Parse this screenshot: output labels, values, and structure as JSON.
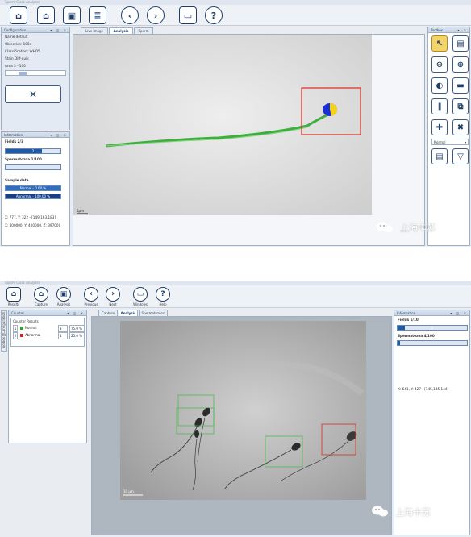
{
  "top": {
    "title": "Sperm Class Analyzer",
    "toolbar_icons": [
      "home-icon",
      "document-home-icon",
      "image-icon",
      "report-icon",
      "previous-icon",
      "next-icon",
      "window-icon",
      "help-icon"
    ],
    "configuration": {
      "header": "Configuration",
      "name": "Name default",
      "objective": "Objective: 100x",
      "classification": "Classification: WHO5",
      "stain": "Stain Diff-quik",
      "area": "Area 5 - 100"
    },
    "information": {
      "header": "Information",
      "fields": "Fields 2/3",
      "fields_bar_value": "2",
      "fields_progress": 0.66,
      "spermatozoa": "Spermatozoa 1/100",
      "spermatozoa_progress": 0.01,
      "sample_data": "Sample data",
      "normal": "Normal - 0.00 %",
      "abnormal": "Abnormal - 100.00 %",
      "coords1": "X: 777, Y: 322 - [149,163,183]",
      "coords2": "X: 400000, Y: 400000, Z: 397000"
    },
    "tabs": [
      "Live image",
      "Analysis",
      "Sperm"
    ],
    "active_tab": "Analysis",
    "scale_label": "5µm",
    "toolbox": {
      "header": "Toolbox",
      "icons": [
        "select-arrow-icon",
        "report-icon",
        "zoom-out-icon",
        "zoom-in-icon",
        "stain-icon",
        "measure-icon",
        "pause-icon",
        "copy-icon",
        "add-icon",
        "delete-icon",
        "save-icon",
        "filter-icon"
      ],
      "dropdown": "Normal"
    },
    "watermark": "上海卡苏"
  },
  "bottom": {
    "title": "Sperm Class Analyzer",
    "toolbar": [
      {
        "label": "Results",
        "icon": "home-icon"
      },
      {
        "label": "Capture",
        "icon": "document-home-icon"
      },
      {
        "label": "Analysis",
        "icon": "image-icon"
      },
      {
        "label": "Previous",
        "icon": "previous-icon"
      },
      {
        "label": "Next",
        "icon": "next-icon"
      },
      {
        "label": "Windows",
        "icon": "window-icon"
      },
      {
        "label": "Help",
        "icon": "help-icon"
      }
    ],
    "side_tabs": [
      "Configuration",
      "Toolbox"
    ],
    "counter": {
      "header": "Counter",
      "title": "Counter Results",
      "rows": [
        {
          "idx": "1",
          "color": "#2ea52e",
          "label": "Normal",
          "count": "3",
          "pct": "75.0 %"
        },
        {
          "idx": "2",
          "color": "#d62020",
          "label": "Abnormal",
          "count": "1",
          "pct": "25.0 %"
        }
      ]
    },
    "tabs": [
      "Capture",
      "Analysis",
      "Spermatozoon"
    ],
    "active_tab": "Analysis",
    "scale_label": "10 µm",
    "information": {
      "header": "Information",
      "fields": "Fields 1/10",
      "fields_bar_value": "1",
      "fields_progress": 0.1,
      "spermatozoa": "Spermatozoa 4/100",
      "spermatozoa_progress": 0.04,
      "coords": "X: 641, Y: 427 - [145,145,144]"
    },
    "watermark": "上海卡苏"
  }
}
